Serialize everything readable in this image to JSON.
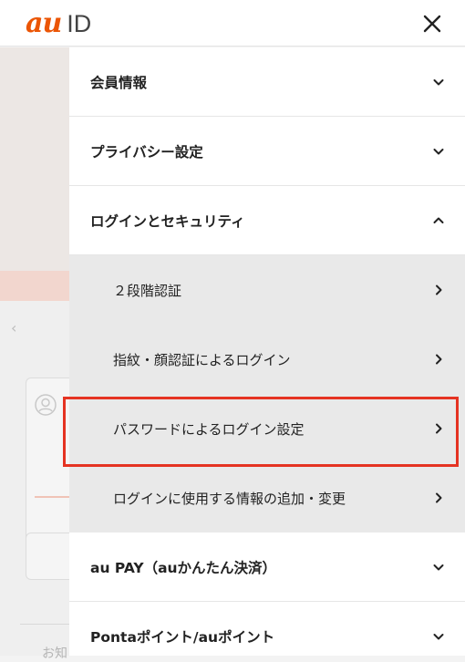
{
  "header": {
    "logo_au": "au",
    "logo_id": "ID",
    "close_icon": "close-icon"
  },
  "background": {
    "partial_text": "お知"
  },
  "menu": {
    "items": [
      {
        "label": "会員情報",
        "icon": "chevron-down-icon"
      },
      {
        "label": "プライバシー設定",
        "icon": "chevron-down-icon"
      },
      {
        "label": "ログインとセキュリティ",
        "icon": "chevron-up-icon"
      }
    ],
    "submenu": [
      {
        "label": "２段階認証",
        "icon": "chevron-right-icon"
      },
      {
        "label": "指紋・顔認証によるログイン",
        "icon": "chevron-right-icon"
      },
      {
        "label": "パスワードによるログイン設定",
        "icon": "chevron-right-icon",
        "highlighted": true
      },
      {
        "label": "ログインに使用する情報の追加・変更",
        "icon": "chevron-right-icon"
      }
    ],
    "items_after": [
      {
        "label": "au PAY（auかんたん決済）",
        "icon": "chevron-down-icon"
      },
      {
        "label": "Pontaポイント/auポイント",
        "icon": "chevron-down-icon"
      }
    ]
  },
  "colors": {
    "brand": "#eb5505",
    "highlight": "#e53322",
    "submenu_bg": "#e9e9e9"
  }
}
